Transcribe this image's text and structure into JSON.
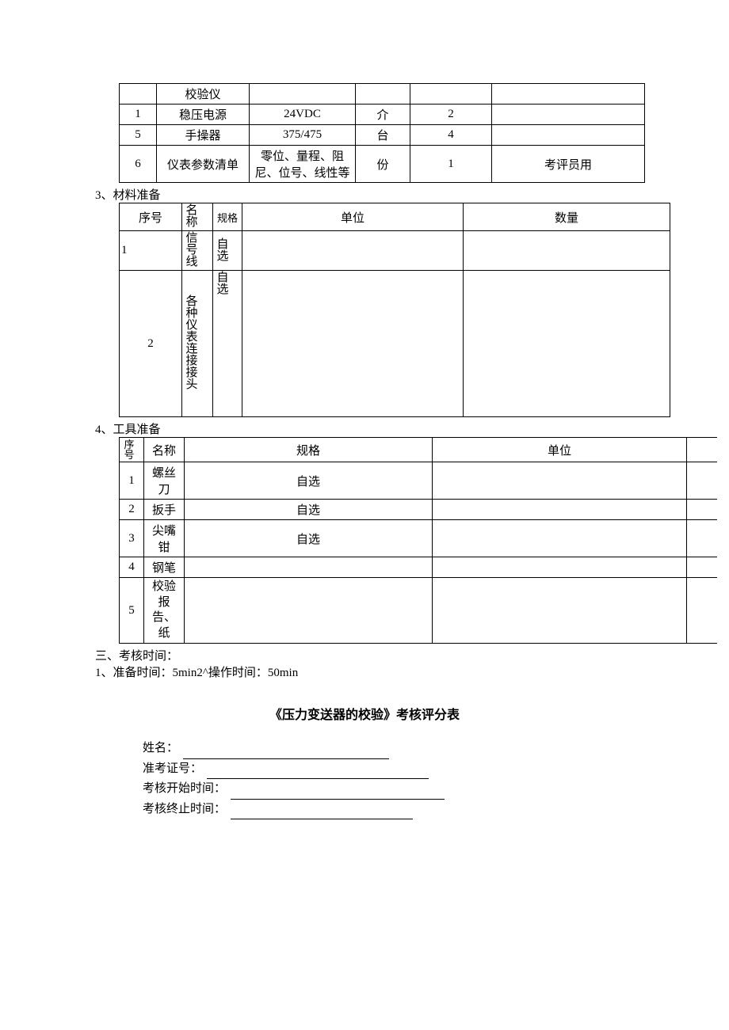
{
  "table1": {
    "rows": [
      {
        "c1": "",
        "c2": "校验仪",
        "c3": "",
        "c4": "",
        "c5": "",
        "c6": ""
      },
      {
        "c1": "1",
        "c2": "稳压电源",
        "c3": "24VDC",
        "c4": "介",
        "c5": "2",
        "c6": ""
      },
      {
        "c1": "5",
        "c2": "手操器",
        "c3": "375/475",
        "c4": "台",
        "c5": "4",
        "c6": ""
      },
      {
        "c1": "6",
        "c2": "仪表参数清单",
        "c3": "零位、量程、阻尼、位号、线性等",
        "c4": "份",
        "c5": "1",
        "c6": "考评员用"
      }
    ]
  },
  "heading3": "3、材料准备",
  "table2": {
    "header": {
      "h1": "序号",
      "h2": "名称",
      "h3": "规格",
      "h4": "单位",
      "h5": "数量"
    },
    "rows": [
      {
        "c1": "1",
        "c2": "信号线",
        "c3": "自选",
        "c4": "",
        "c5": ""
      },
      {
        "c1": "2",
        "c2": "各种仪表连接接头",
        "c3": "自选",
        "c4": "",
        "c5": ""
      }
    ]
  },
  "heading4": "4、工具准备",
  "table3": {
    "header": {
      "h1": "序号",
      "h2": "名称",
      "h3": "规格",
      "h4": "单位"
    },
    "rows": [
      {
        "c1": "1",
        "c2": "螺丝刀",
        "c3": "自选",
        "c4": ""
      },
      {
        "c1": "2",
        "c2": "扳手",
        "c3": "自选",
        "c4": ""
      },
      {
        "c1": "3",
        "c2": "尖嘴钳",
        "c3": "自选",
        "c4": ""
      },
      {
        "c1": "4",
        "c2": "钢笔",
        "c3": "",
        "c4": ""
      },
      {
        "c1": "5",
        "c2": "校验报告、纸",
        "c3": "",
        "c4": ""
      }
    ]
  },
  "section3_heading": "三、考核时间：",
  "section3_text": "1、准备时间：5min2^操作时间：50min",
  "scoring_title": "《压力变送器的校验》考核评分表",
  "form": {
    "name_label": "姓名：",
    "id_label": "准考证号：",
    "start_label": "考核开始时间：",
    "end_label": "考核终止时间："
  }
}
